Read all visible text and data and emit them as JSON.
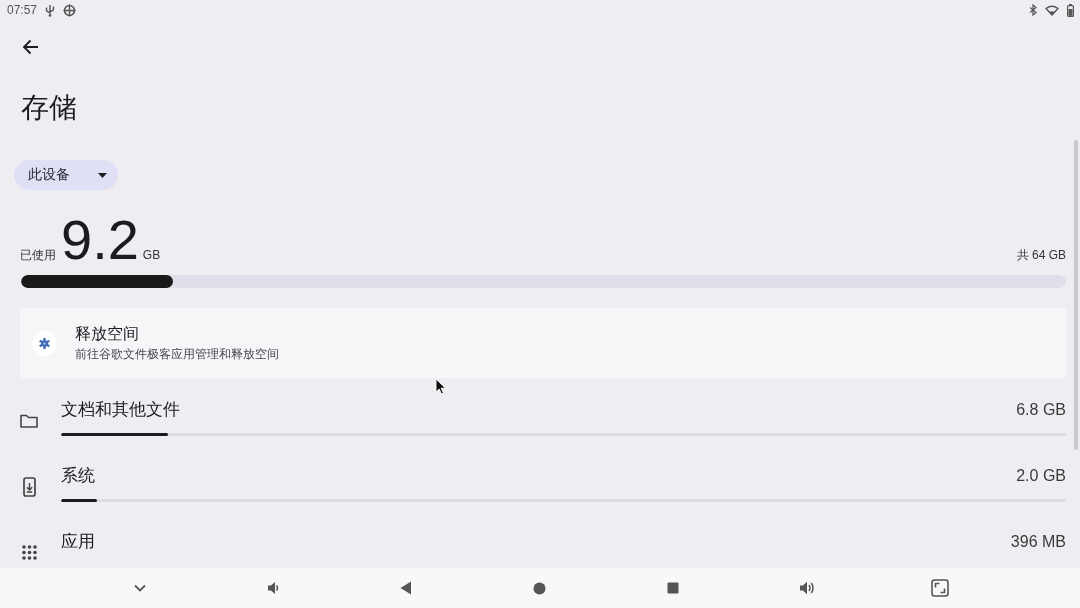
{
  "status_bar": {
    "time": "07:57"
  },
  "header": {
    "title": "存储"
  },
  "device_selector": {
    "value": "此设备"
  },
  "usage": {
    "used_label": "已使用",
    "used_value": "9.2",
    "used_unit": "GB",
    "total": "共 64 GB",
    "level": 0.145
  },
  "free_up_card": {
    "title": "释放空间",
    "subtitle": "前往谷歌文件极客应用管理和释放空间"
  },
  "categories": [
    {
      "kind": "documents",
      "name": "文档和其他文件",
      "size": "6.8 GB",
      "level": 0.106
    },
    {
      "kind": "system",
      "name": "系统",
      "size": "2.0 GB",
      "level": 0.036
    },
    {
      "kind": "apps",
      "name": "应用",
      "size": "396 MB"
    }
  ]
}
